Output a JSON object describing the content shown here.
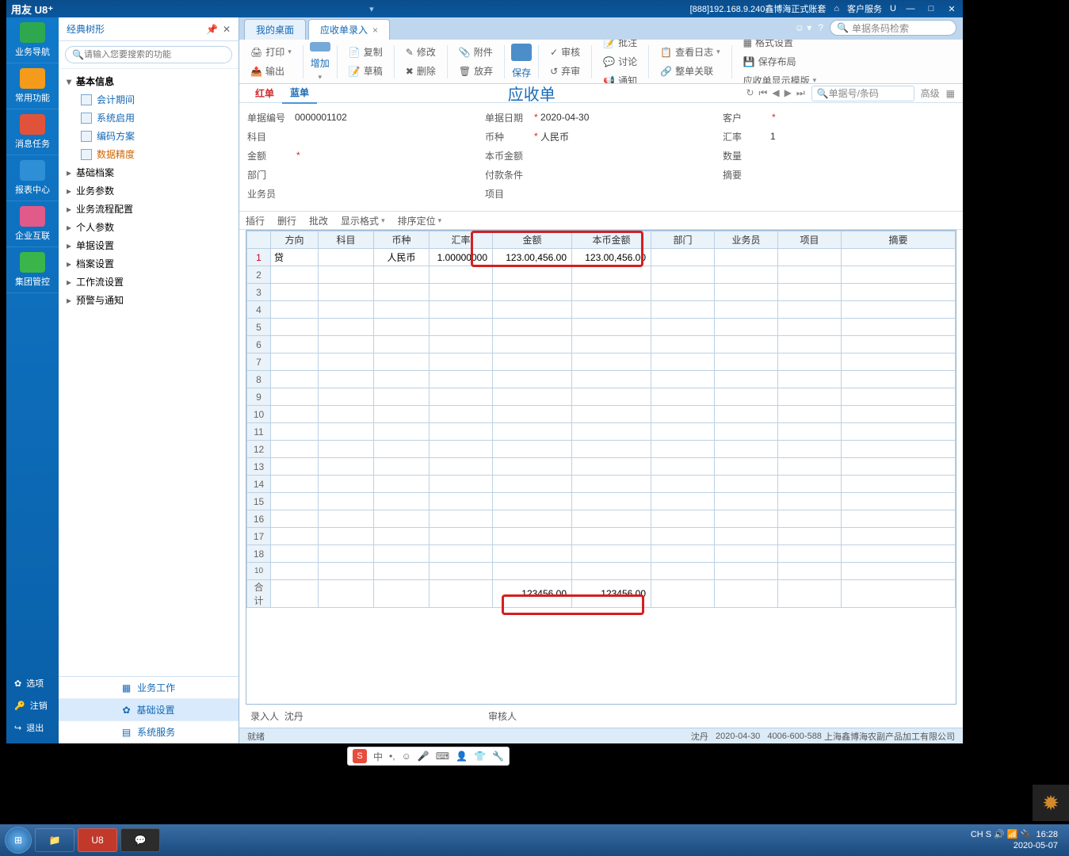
{
  "titlebar": {
    "brand": "用友 U8⁺",
    "center_info": "[888]192.168.9.240鑫博海正式账套",
    "service": "客户服务",
    "u_sym": "U"
  },
  "leftbar": {
    "items": [
      {
        "label": "业务导航",
        "color": "#2ea84f"
      },
      {
        "label": "常用功能",
        "color": "#f49b1b"
      },
      {
        "label": "消息任务",
        "color": "#e0533a"
      },
      {
        "label": "报表中心",
        "color": "#2f8fd6"
      },
      {
        "label": "企业互联",
        "color": "#e25a8a"
      },
      {
        "label": "集团管控",
        "color": "#3ab54a"
      }
    ],
    "bottom": [
      {
        "label": "选项"
      },
      {
        "label": "注销"
      },
      {
        "label": "退出"
      }
    ]
  },
  "tree": {
    "title": "经典树形",
    "search_placeholder": "请输入您要搜索的功能",
    "group_basic": "基本信息",
    "leaves": [
      "会计期间",
      "系统启用",
      "编码方案",
      "数据精度"
    ],
    "sel_index": 3,
    "nodes": [
      "基础档案",
      "业务参数",
      "业务流程配置",
      "个人参数",
      "单据设置",
      "档案设置",
      "工作流设置",
      "预警与通知"
    ],
    "bottom_tabs": [
      "业务工作",
      "基础设置",
      "系统服务"
    ],
    "bottom_active": 1
  },
  "tabs": {
    "items": [
      "我的桌面",
      "应收单录入"
    ],
    "active": 1,
    "search_placeholder": "单据条码检索"
  },
  "ribbon": {
    "r1": [
      "打印",
      "输出"
    ],
    "r2": "增加",
    "r3": [
      "复制",
      "草稿"
    ],
    "r4": [
      "修改",
      "删除"
    ],
    "r5": [
      "附件",
      "放弃"
    ],
    "r6": "保存",
    "r7": [
      "审核",
      "弃审"
    ],
    "r8": [
      "批注",
      "讨论",
      "通知"
    ],
    "r9": [
      "查看日志",
      "整单关联"
    ],
    "r10": [
      "格式设置",
      "保存布局",
      "应收单显示模版"
    ]
  },
  "doc": {
    "tab_red": "红单",
    "tab_blue": "蓝单",
    "title": "应收单",
    "nav_search_placeholder": "单据号/条码",
    "nav_adv": "高级",
    "fields": {
      "no_lbl": "单据编号",
      "no": "0000001102",
      "date_lbl": "单据日期",
      "date": "2020-04-30",
      "cust_lbl": "客户",
      "subj_lbl": "科目",
      "curr_lbl": "币种",
      "curr": "人民币",
      "rate_lbl": "汇率",
      "rate": "1",
      "amt_lbl": "金额",
      "loc_amt_lbl": "本币金额",
      "qty_lbl": "数量",
      "dept_lbl": "部门",
      "pay_lbl": "付款条件",
      "memo_lbl": "摘要",
      "sales_lbl": "业务员",
      "proj_lbl": "项目"
    }
  },
  "gridtools": [
    "插行",
    "删行",
    "批改",
    "显示格式",
    "排序定位"
  ],
  "grid": {
    "headers": [
      "方向",
      "科目",
      "币种",
      "汇率",
      "金额",
      "本币金额",
      "部门",
      "业务员",
      "项目",
      "摘要"
    ],
    "row": {
      "dir": "贷",
      "curr": "人民币",
      "rate": "1.00000000",
      "amt": "123.00,456.00",
      "loc": "123.00,456.00"
    },
    "total_lbl": "合计",
    "total_amt": "123456.00",
    "total_loc": "123456.00"
  },
  "footer": {
    "entry_lbl": "录入人",
    "entry": "沈丹",
    "audit_lbl": "审核人"
  },
  "status": {
    "ready": "就绪",
    "user": "沈丹",
    "date": "2020-04-30",
    "phone": "4006-600-588",
    "company": "上海鑫博海农副产品加工有限公司"
  },
  "taskbar": {
    "time": "16:28",
    "date": "2020-05-07",
    "cn": "CH"
  },
  "ime": {
    "label": "中"
  }
}
